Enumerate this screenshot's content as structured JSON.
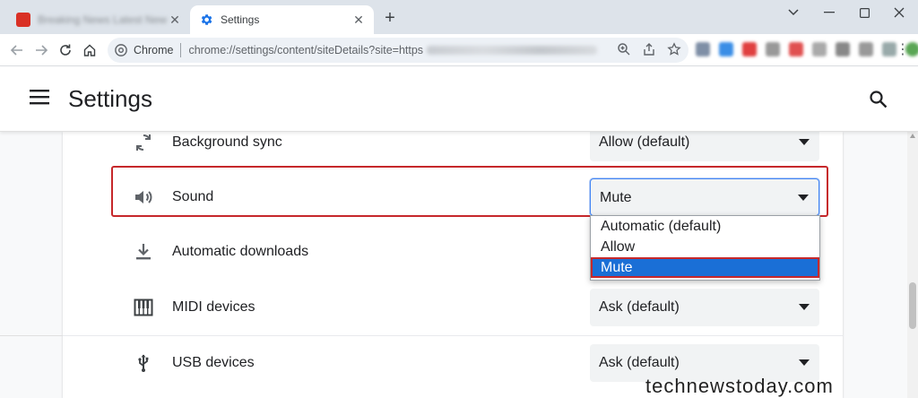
{
  "browser": {
    "tabs": [
      {
        "title": "Breaking News Latest News and Videos"
      },
      {
        "title": "Settings"
      }
    ],
    "omnibox": {
      "chip": "Chrome",
      "url": "chrome://settings/content/siteDetails?site=https"
    }
  },
  "settings": {
    "title": "Settings"
  },
  "permissions": [
    {
      "label": "Background sync",
      "value": "Allow (default)",
      "icon": "sync-icon"
    },
    {
      "label": "Sound",
      "value": "Mute",
      "icon": "speaker-icon"
    },
    {
      "label": "Automatic downloads",
      "value": "",
      "icon": "download-icon"
    },
    {
      "label": "MIDI devices",
      "value": "Ask (default)",
      "icon": "piano-icon"
    },
    {
      "label": "USB devices",
      "value": "Ask (default)",
      "icon": "usb-icon"
    }
  ],
  "sound_dropdown": {
    "options": [
      "Automatic (default)",
      "Allow",
      "Mute"
    ],
    "selected": "Mute"
  },
  "colors": {
    "highlight": "#c6282b",
    "selection": "#1a6fd6"
  },
  "watermark": "technewstoday.com"
}
